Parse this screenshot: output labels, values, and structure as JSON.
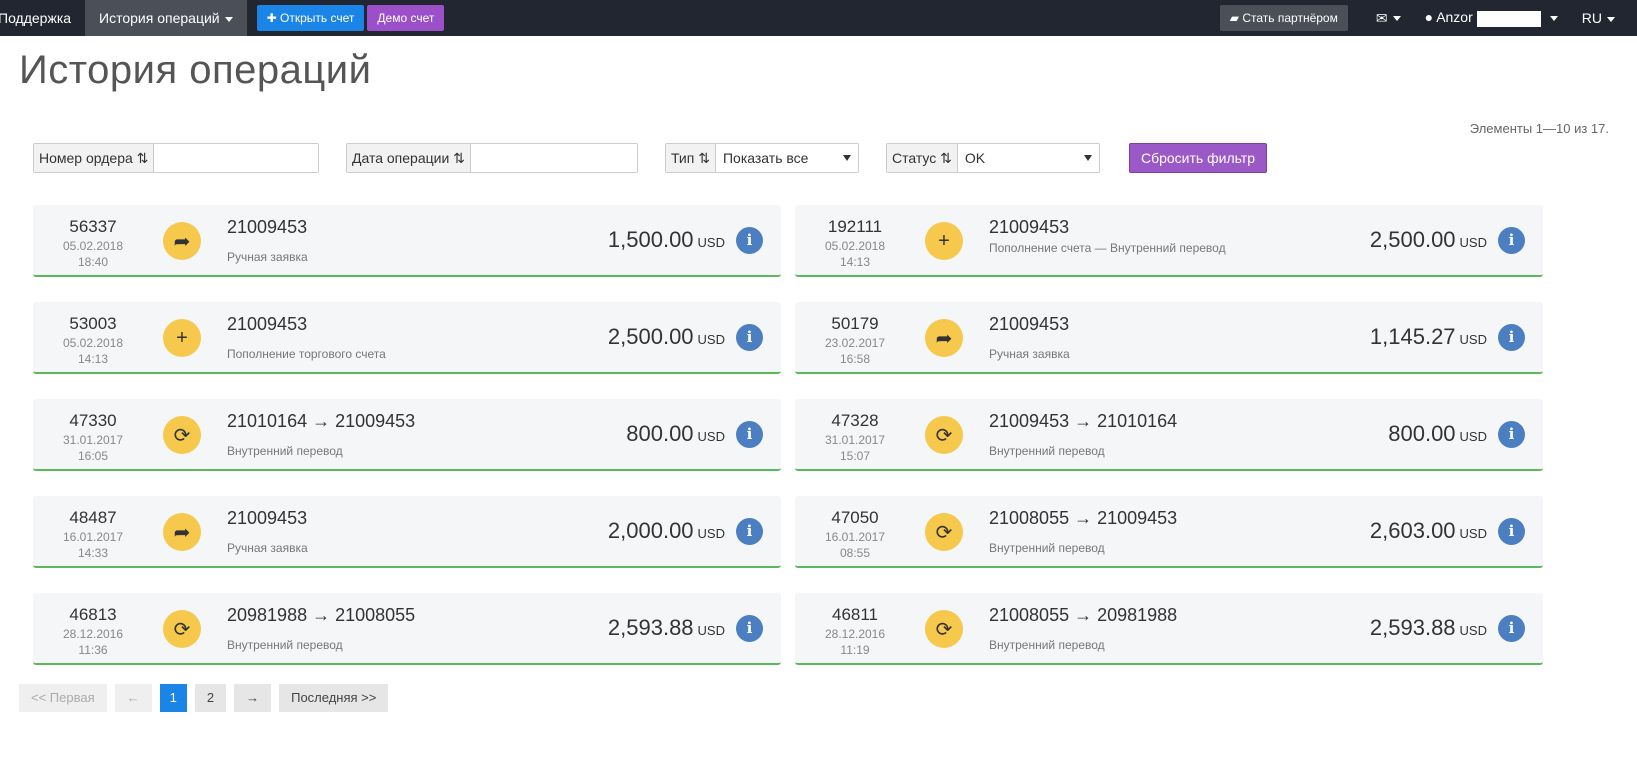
{
  "navbar": {
    "support": "Поддержка",
    "history": "История операций",
    "open_account": "Открыть счет",
    "demo_account": "Демо счет",
    "become_partner": "Стать партнёром",
    "user": "Anzor",
    "language": "RU"
  },
  "page": {
    "title": "История операций",
    "elements_count": "Элементы 1—10 из 17."
  },
  "filters": {
    "order_number_label": "Номер ордера",
    "order_number_value": "",
    "date_label": "Дата операции",
    "date_value": "",
    "type_label": "Тип",
    "type_value": "Показать все",
    "status_label": "Статус",
    "status_value": "OK",
    "reset_label": "Сбросить фильтр"
  },
  "operations": [
    {
      "id": "56337",
      "date": "05.02.2018",
      "time": "18:40",
      "icon": "share-arrow-icon",
      "account": "21009453",
      "desc": "Ручная заявка",
      "amount": "1,500.00",
      "currency": "USD"
    },
    {
      "id": "192111",
      "date": "05.02.2018",
      "time": "14:13",
      "icon": "plus-icon",
      "account": "21009453",
      "desc": "Пополнение счета — Внутренний перевод",
      "amount": "2,500.00",
      "currency": "USD"
    },
    {
      "id": "53003",
      "date": "05.02.2018",
      "time": "14:13",
      "icon": "plus-icon",
      "account": "21009453",
      "desc": "Пополнение торгового счета",
      "amount": "2,500.00",
      "currency": "USD"
    },
    {
      "id": "50179",
      "date": "23.02.2017",
      "time": "16:58",
      "icon": "share-arrow-icon",
      "account": "21009453",
      "desc": "Ручная заявка",
      "amount": "1,145.27",
      "currency": "USD"
    },
    {
      "id": "47330",
      "date": "31.01.2017",
      "time": "16:05",
      "icon": "refresh-icon",
      "account": "21010164 → 21009453",
      "desc": "Внутренний перевод",
      "amount": "800.00",
      "currency": "USD"
    },
    {
      "id": "47328",
      "date": "31.01.2017",
      "time": "15:07",
      "icon": "refresh-icon",
      "account": "21009453 → 21010164",
      "desc": "Внутренний перевод",
      "amount": "800.00",
      "currency": "USD"
    },
    {
      "id": "48487",
      "date": "16.01.2017",
      "time": "14:33",
      "icon": "share-arrow-icon",
      "account": "21009453",
      "desc": "Ручная заявка",
      "amount": "2,000.00",
      "currency": "USD"
    },
    {
      "id": "47050",
      "date": "16.01.2017",
      "time": "08:55",
      "icon": "refresh-icon",
      "account": "21008055 → 21009453",
      "desc": "Внутренний перевод",
      "amount": "2,603.00",
      "currency": "USD"
    },
    {
      "id": "46813",
      "date": "28.12.2016",
      "time": "11:36",
      "icon": "refresh-icon",
      "account": "20981988 → 21008055",
      "desc": "Внутренний перевод",
      "amount": "2,593.88",
      "currency": "USD"
    },
    {
      "id": "46811",
      "date": "28.12.2016",
      "time": "11:19",
      "icon": "refresh-icon",
      "account": "21008055 → 20981988",
      "desc": "Внутренний перевод",
      "amount": "2,593.88",
      "currency": "USD"
    }
  ],
  "pagination": {
    "first": "<< Первая",
    "prev": "←",
    "page1": "1",
    "page2": "2",
    "next": "→",
    "last": "Последняя >>"
  }
}
